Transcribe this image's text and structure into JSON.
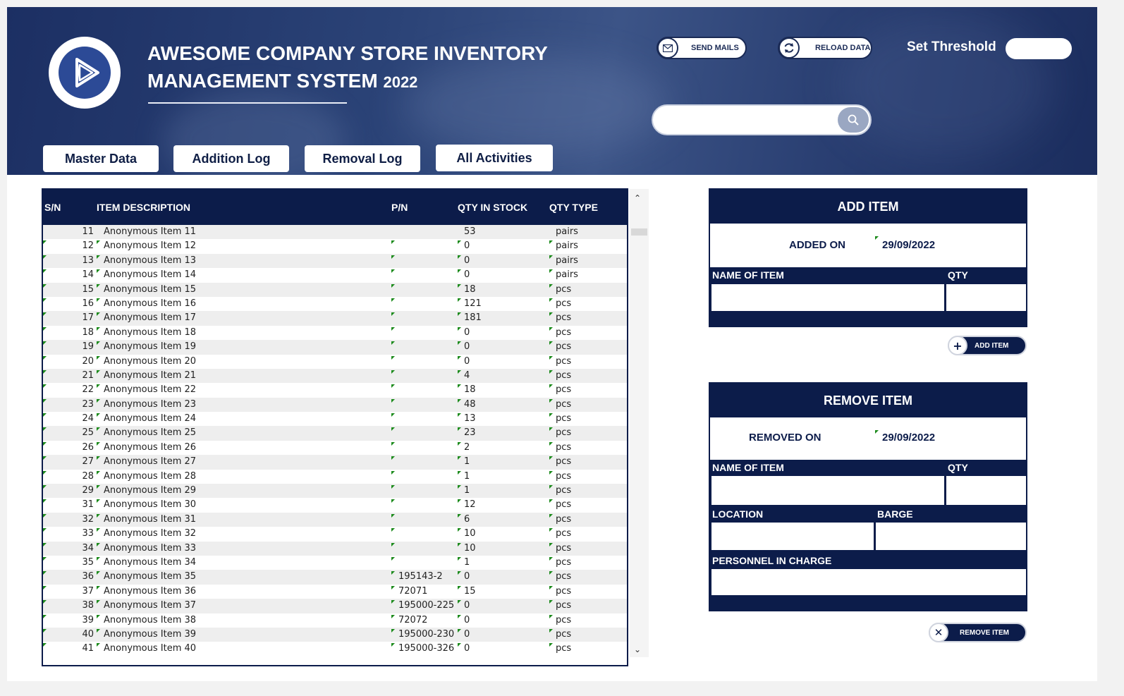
{
  "header": {
    "title_line1": "AWESOME COMPANY STORE INVENTORY",
    "title_line2": "MANAGEMENT SYSTEM",
    "title_year": "2022",
    "send_mails_label": "SEND MAILS",
    "reload_data_label": "RELOAD DATA",
    "threshold_label": "Set Threshold",
    "threshold_value": "",
    "search_value": ""
  },
  "tabs": [
    "Master Data",
    "Addition Log",
    "Removal Log",
    "All Activities"
  ],
  "table": {
    "columns": [
      "S/N",
      "ITEM DESCRIPTION",
      "P/N",
      "QTY IN STOCK",
      "QTY TYPE"
    ],
    "rows": [
      {
        "sn": "11",
        "desc": "Anonymous Item 11",
        "pn": "",
        "qty": "53",
        "type": "pairs"
      },
      {
        "sn": "12",
        "desc": "Anonymous Item 12",
        "pn": "",
        "qty": "0",
        "type": "pairs"
      },
      {
        "sn": "13",
        "desc": "Anonymous Item 13",
        "pn": "",
        "qty": "0",
        "type": "pairs"
      },
      {
        "sn": "14",
        "desc": "Anonymous Item 14",
        "pn": "",
        "qty": "0",
        "type": "pairs"
      },
      {
        "sn": "15",
        "desc": "Anonymous Item 15",
        "pn": "",
        "qty": "18",
        "type": "pcs"
      },
      {
        "sn": "16",
        "desc": "Anonymous Item 16",
        "pn": "",
        "qty": "121",
        "type": "pcs"
      },
      {
        "sn": "17",
        "desc": "Anonymous Item 17",
        "pn": "",
        "qty": "181",
        "type": "pcs"
      },
      {
        "sn": "18",
        "desc": "Anonymous Item 18",
        "pn": "",
        "qty": "0",
        "type": "pcs"
      },
      {
        "sn": "19",
        "desc": "Anonymous Item 19",
        "pn": "",
        "qty": "0",
        "type": "pcs"
      },
      {
        "sn": "20",
        "desc": "Anonymous Item 20",
        "pn": "",
        "qty": "0",
        "type": "pcs"
      },
      {
        "sn": "21",
        "desc": "Anonymous Item 21",
        "pn": "",
        "qty": "4",
        "type": "pcs"
      },
      {
        "sn": "22",
        "desc": "Anonymous Item 22",
        "pn": "",
        "qty": "18",
        "type": "pcs"
      },
      {
        "sn": "23",
        "desc": "Anonymous Item 23",
        "pn": "",
        "qty": "48",
        "type": "pcs"
      },
      {
        "sn": "24",
        "desc": "Anonymous Item 24",
        "pn": "",
        "qty": "13",
        "type": "pcs"
      },
      {
        "sn": "25",
        "desc": "Anonymous Item 25",
        "pn": "",
        "qty": "23",
        "type": "pcs"
      },
      {
        "sn": "26",
        "desc": "Anonymous Item 26",
        "pn": "",
        "qty": "2",
        "type": "pcs"
      },
      {
        "sn": "27",
        "desc": "Anonymous Item 27",
        "pn": "",
        "qty": "1",
        "type": "pcs"
      },
      {
        "sn": "28",
        "desc": "Anonymous Item 28",
        "pn": "",
        "qty": "1",
        "type": "pcs"
      },
      {
        "sn": "29",
        "desc": "Anonymous Item 29",
        "pn": "",
        "qty": "1",
        "type": "pcs"
      },
      {
        "sn": "31",
        "desc": "Anonymous Item 30",
        "pn": "",
        "qty": "12",
        "type": "pcs"
      },
      {
        "sn": "32",
        "desc": "Anonymous Item 31",
        "pn": "",
        "qty": "6",
        "type": "pcs"
      },
      {
        "sn": "33",
        "desc": "Anonymous Item 32",
        "pn": "",
        "qty": "10",
        "type": "pcs"
      },
      {
        "sn": "34",
        "desc": "Anonymous Item 33",
        "pn": "",
        "qty": "10",
        "type": "pcs"
      },
      {
        "sn": "35",
        "desc": "Anonymous Item 34",
        "pn": "",
        "qty": "1",
        "type": "pcs"
      },
      {
        "sn": "36",
        "desc": "Anonymous Item 35",
        "pn": "195143-2",
        "qty": "0",
        "type": "pcs"
      },
      {
        "sn": "37",
        "desc": "Anonymous Item 36",
        "pn": "72071",
        "qty": "15",
        "type": "pcs"
      },
      {
        "sn": "38",
        "desc": "Anonymous Item 37",
        "pn": "195000-225",
        "qty": "0",
        "type": "pcs"
      },
      {
        "sn": "39",
        "desc": "Anonymous Item 38",
        "pn": "72072",
        "qty": "0",
        "type": "pcs"
      },
      {
        "sn": "40",
        "desc": "Anonymous Item 39",
        "pn": "195000-230",
        "qty": "0",
        "type": "pcs"
      },
      {
        "sn": "41",
        "desc": "Anonymous Item 40",
        "pn": "195000-326",
        "qty": "0",
        "type": "pcs"
      }
    ]
  },
  "add_item": {
    "title": "ADD ITEM",
    "added_on_label": "ADDED ON",
    "added_on_value": "29/09/2022",
    "name_label": "NAME OF ITEM",
    "qty_label": "QTY",
    "button_label": "ADD ITEM"
  },
  "remove_item": {
    "title": "REMOVE ITEM",
    "removed_on_label": "REMOVED ON",
    "removed_on_value": "29/09/2022",
    "name_label": "NAME OF ITEM",
    "qty_label": "QTY",
    "location_label": "LOCATION",
    "barge_label": "BARGE",
    "personnel_label": "PERSONNEL IN CHARGE",
    "button_label": "REMOVE ITEM"
  },
  "colors": {
    "navy": "#0c1c4a",
    "logo_blue": "#2c4a96",
    "green_marker": "#1b8a1b"
  }
}
